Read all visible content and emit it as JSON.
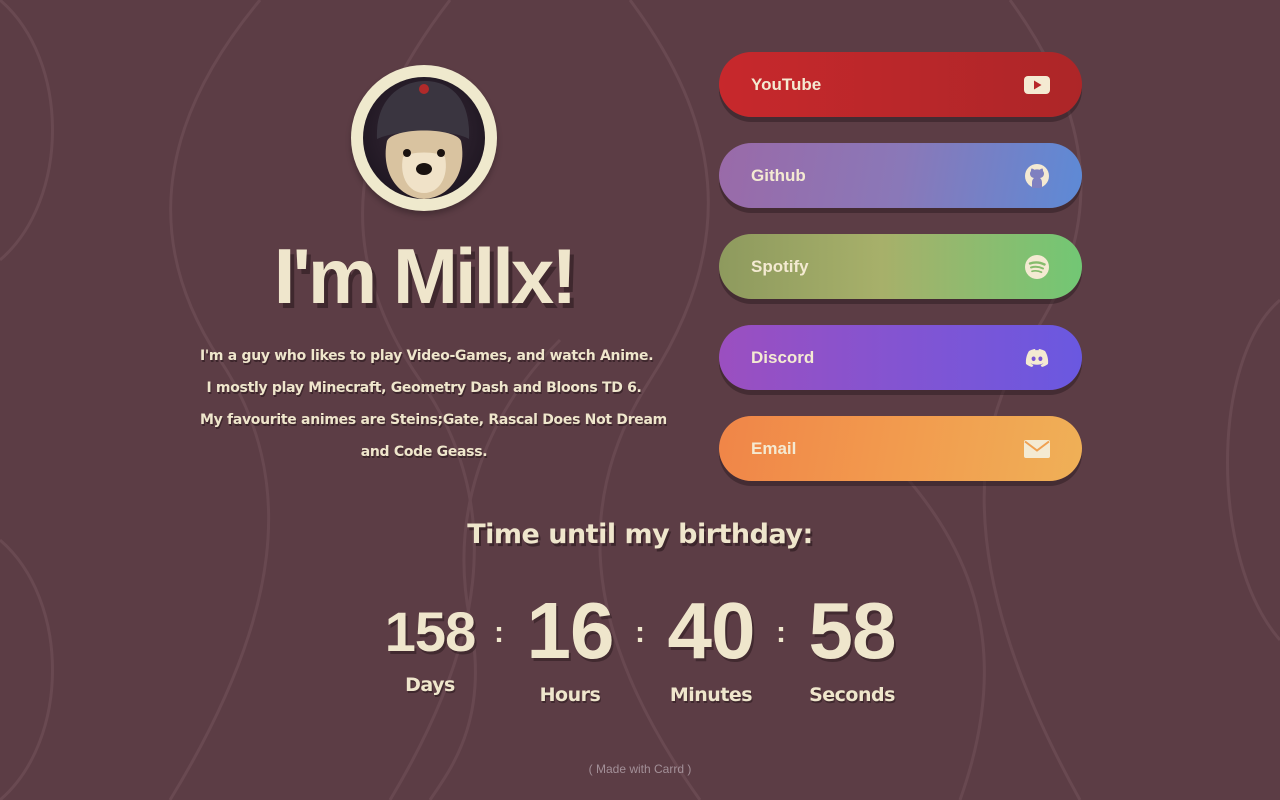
{
  "colors": {
    "background": "#5c3d45",
    "text": "#efe6cc",
    "youtube": "#c7282c",
    "github": "#8a78b8",
    "spotify": "#72c774",
    "discord": "#7e55d5",
    "email": "#f29b4e"
  },
  "profile": {
    "avatar_icon": "dog-photo",
    "heading": "I'm Millx!",
    "bio_lines": [
      "I'm a guy who likes to play Video-Games, and watch Anime.",
      "I mostly play Minecraft, Geometry Dash and Bloons TD 6.",
      "My favourite animes are Steins;Gate, Rascal Does Not Dream",
      "and Code Geass."
    ]
  },
  "links": [
    {
      "label": "YouTube",
      "icon": "youtube-icon"
    },
    {
      "label": "Github",
      "icon": "github-icon"
    },
    {
      "label": "Spotify",
      "icon": "spotify-icon"
    },
    {
      "label": "Discord",
      "icon": "discord-icon"
    },
    {
      "label": "Email",
      "icon": "email-icon"
    }
  ],
  "countdown": {
    "title": "Time until my birthday:",
    "separator": ":",
    "units": [
      {
        "value": "158",
        "label": "Days"
      },
      {
        "value": "16",
        "label": "Hours"
      },
      {
        "value": "40",
        "label": "Minutes"
      },
      {
        "value": "58",
        "label": "Seconds"
      }
    ]
  },
  "footer": {
    "text": "( Made with Carrd )"
  }
}
